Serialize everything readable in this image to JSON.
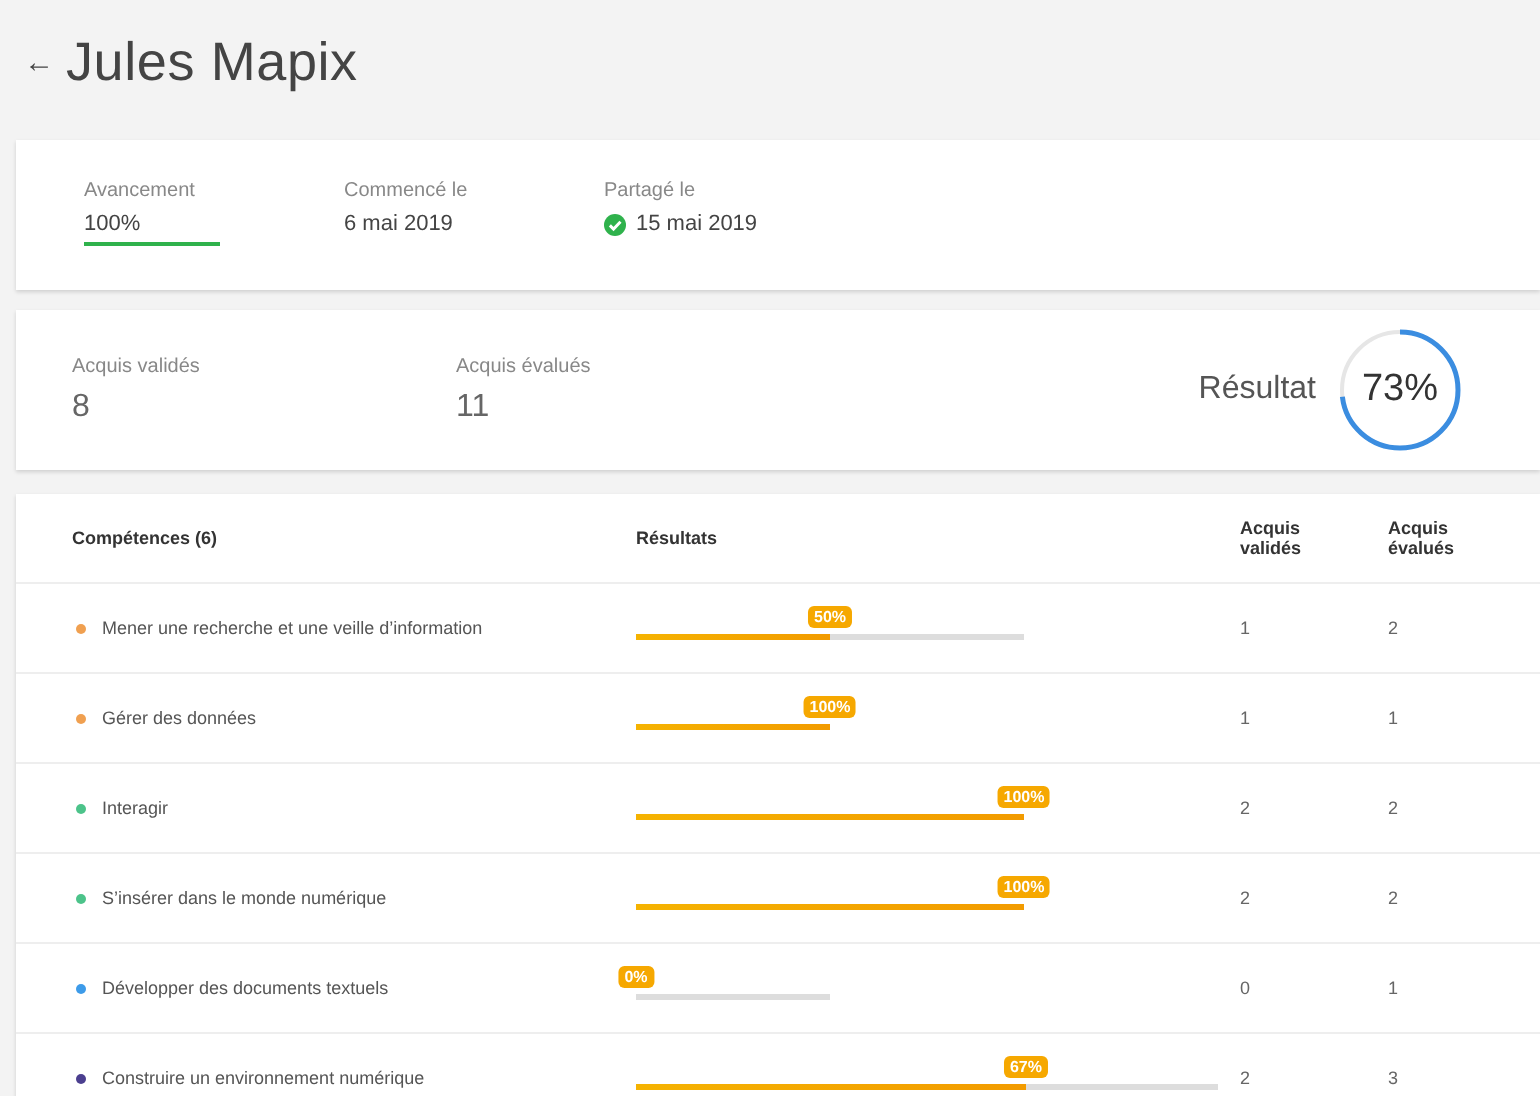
{
  "header": {
    "back": "←",
    "title": "Jules Mapix"
  },
  "progress_card": {
    "fields": [
      {
        "label": "Avancement",
        "value": "100%",
        "level": 1,
        "kind": "progress"
      },
      {
        "label": "Commencé le",
        "value": "6 mai 2019",
        "kind": "date"
      },
      {
        "label": "Partagé le",
        "value": "15 mai 2019",
        "kind": "check"
      }
    ]
  },
  "summary_card": {
    "stats": [
      {
        "label": "Acquis validés",
        "value": "8"
      },
      {
        "label": "Acquis évalués",
        "value": "11"
      }
    ],
    "result": {
      "label": "Résultat",
      "value": "73%",
      "level": 0.73
    }
  },
  "table": {
    "columns": [
      "Compétences (6)",
      "Résultats",
      "Acquis validés",
      "Acquis évalués"
    ],
    "rows": [
      {
        "name": "Mener une recherche et une veille d’information",
        "color": "#f0a050",
        "badge": "50%",
        "level": 0.5,
        "validated": "1",
        "evaluated": "2"
      },
      {
        "name": "Gérer des données",
        "color": "#f0a050",
        "badge": "100%",
        "level": 1,
        "validated": "1",
        "evaluated": "1"
      },
      {
        "name": "Interagir",
        "color": "#4cc38a",
        "badge": "100%",
        "level": 1,
        "validated": "2",
        "evaluated": "2"
      },
      {
        "name": "S’insérer dans le monde numérique",
        "color": "#4cc38a",
        "badge": "100%",
        "level": 1,
        "validated": "2",
        "evaluated": "2"
      },
      {
        "name": "Développer des documents textuels",
        "color": "#3d9be9",
        "badge": "0%",
        "level": 0,
        "validated": "0",
        "evaluated": "1"
      },
      {
        "name": "Construire un environnement numérique",
        "color": "#4b3f8f",
        "badge": "67%",
        "level": 0.67,
        "validated": "2",
        "evaluated": "3"
      }
    ]
  }
}
